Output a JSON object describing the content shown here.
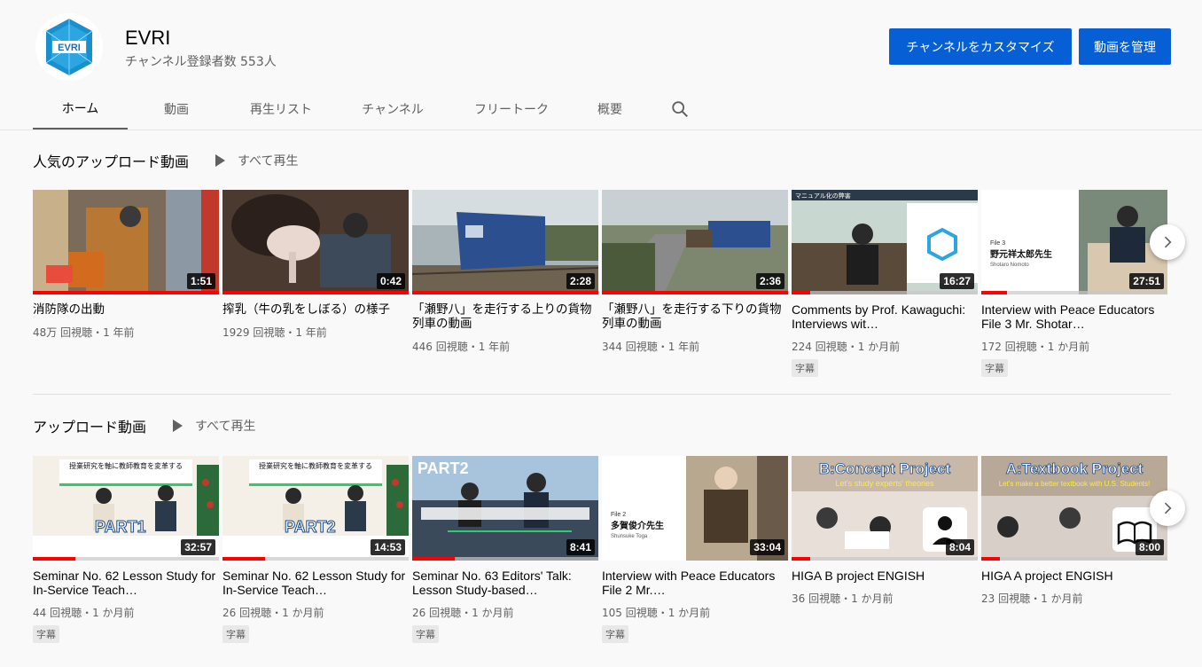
{
  "channel": {
    "name": "EVRI",
    "subscribers": "チャンネル登録者数 553人",
    "avatar_text": "EVRI",
    "customize_label": "チャンネルをカスタマイズ",
    "manage_label": "動画を管理"
  },
  "tabs": [
    {
      "label": "ホーム",
      "active": true
    },
    {
      "label": "動画"
    },
    {
      "label": "再生リスト"
    },
    {
      "label": "チャンネル"
    },
    {
      "label": "フリートーク"
    },
    {
      "label": "概要"
    }
  ],
  "shelves": [
    {
      "title": "人気のアップロード動画",
      "play_all": "すべて再生",
      "videos": [
        {
          "title": "消防隊の出動",
          "meta": "48万 回視聴・1 年前",
          "duration": "1:51",
          "progress": 1.0,
          "badge": ""
        },
        {
          "title": "搾乳（牛の乳をしぼる）の様子",
          "meta": "1929 回視聴・1 年前",
          "duration": "0:42",
          "progress": 1.0,
          "badge": ""
        },
        {
          "title": "「瀬野八」を走行する上りの貨物列車の動画",
          "meta": "446 回視聴・1 年前",
          "duration": "2:28",
          "progress": 1.0,
          "badge": ""
        },
        {
          "title": "「瀬野八」を走行する下りの貨物列車の動画",
          "meta": "344 回視聴・1 年前",
          "duration": "2:36",
          "progress": 1.0,
          "badge": ""
        },
        {
          "title": "Comments by Prof. Kawaguchi: Interviews wit…",
          "meta": "224 回視聴・1 か月前",
          "duration": "16:27",
          "progress": 0.1,
          "badge": "字幕",
          "thumb_text": "マニュアル化の弊害"
        },
        {
          "title": "Interview with Peace Educators File 3 Mr. Shotar…",
          "meta": "172 回視聴・1 か月前",
          "duration": "27:51",
          "progress": 0.14,
          "badge": "字幕",
          "thumb_text": "野元祥太郎先生",
          "thumb_sub": "Shotaro Nomoto",
          "thumb_file": "File 3"
        }
      ]
    },
    {
      "title": "アップロード動画",
      "play_all": "すべて再生",
      "videos": [
        {
          "title": "Seminar No. 62 Lesson Study for In-Service Teach…",
          "meta": "44 回視聴・1 か月前",
          "duration": "32:57",
          "progress": 0.23,
          "badge": "字幕",
          "thumb_text": "PART1",
          "thumb_head": "授業研究を軸に教師教育を変革する"
        },
        {
          "title": "Seminar No. 62 Lesson Study for In-Service Teach…",
          "meta": "26 回視聴・1 か月前",
          "duration": "14:53",
          "progress": 0.23,
          "badge": "字幕",
          "thumb_text": "PART2",
          "thumb_head": "授業研究を軸に教師教育を変革する"
        },
        {
          "title": "Seminar No. 63 Editors' Talk: Lesson Study-based…",
          "meta": "26 回視聴・1 か月前",
          "duration": "8:41",
          "progress": 0.23,
          "badge": "字幕",
          "thumb_text": "PART2"
        },
        {
          "title": "Interview with Peace Educators File 2 Mr.…",
          "meta": "105 回視聴・1 か月前",
          "duration": "33:04",
          "progress": 0.0,
          "badge": "字幕",
          "thumb_text": "多賀俊介先生",
          "thumb_sub": "Shunsuke Toga",
          "thumb_file": "File 2"
        },
        {
          "title": "HIGA B project ENGISH",
          "meta": "36 回視聴・1 か月前",
          "duration": "8:04",
          "progress": 0.1,
          "badge": "",
          "thumb_text": "B:Concept Project",
          "thumb_head": "Let's study experts' theories"
        },
        {
          "title": "HIGA A project ENGISH",
          "meta": "23 回視聴・1 か月前",
          "duration": "8:00",
          "progress": 0.1,
          "badge": "",
          "thumb_text": "A:Textbook Project",
          "thumb_head": "Let's make a better textbook with U.S. Students!"
        }
      ]
    }
  ]
}
